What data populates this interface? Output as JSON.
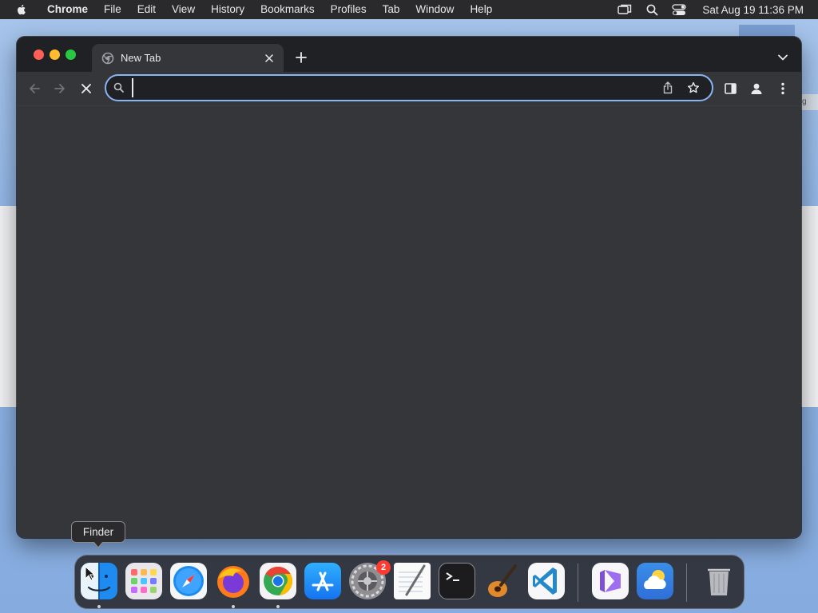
{
  "menubar": {
    "app_name": "Chrome",
    "items": [
      "File",
      "Edit",
      "View",
      "History",
      "Bookmarks",
      "Profiles",
      "Tab",
      "Window",
      "Help"
    ],
    "clock": "Sat Aug 19  11:36 PM",
    "icons": [
      "apple-icon",
      "screen-mirroring-icon",
      "spotlight-search-icon",
      "control-center-icon"
    ]
  },
  "browser": {
    "tab": {
      "title": "New Tab",
      "favicon": "chrome-newtab-icon"
    },
    "omnibox": {
      "value": "",
      "placeholder": ""
    },
    "toolbar_icons": [
      "back-icon",
      "forward-icon",
      "stop-icon",
      "share-icon",
      "bookmark-star-icon",
      "side-panel-icon",
      "profile-icon",
      "kebab-menu-icon"
    ],
    "colors": {
      "frame": "#202124",
      "toolbar": "#35363a",
      "focus_ring": "#8ab4f8"
    }
  },
  "dock": {
    "tooltip": "Finder",
    "apps": [
      {
        "name": "Finder",
        "icon": "finder-icon",
        "running": true
      },
      {
        "name": "Launchpad",
        "icon": "launchpad-icon",
        "running": false
      },
      {
        "name": "Safari",
        "icon": "safari-icon",
        "running": false
      },
      {
        "name": "Firefox",
        "icon": "firefox-icon",
        "running": true
      },
      {
        "name": "Google Chrome",
        "icon": "chrome-icon",
        "running": true
      },
      {
        "name": "App Store",
        "icon": "app-store-icon",
        "running": false
      },
      {
        "name": "System Settings",
        "icon": "system-settings-icon",
        "running": false,
        "badge": "2"
      },
      {
        "name": "TextEdit",
        "icon": "textedit-icon",
        "running": false
      },
      {
        "name": "Terminal",
        "icon": "terminal-icon",
        "running": false
      },
      {
        "name": "GarageBand",
        "icon": "garageband-icon",
        "running": false
      },
      {
        "name": "Visual Studio Code",
        "icon": "vscode-icon",
        "running": false
      },
      {
        "name": "Visual Studio",
        "icon": "visual-studio-icon",
        "running": false
      },
      {
        "name": "Weather",
        "icon": "weather-icon",
        "running": false
      },
      {
        "name": "Trash",
        "icon": "trash-icon",
        "running": false
      }
    ]
  }
}
